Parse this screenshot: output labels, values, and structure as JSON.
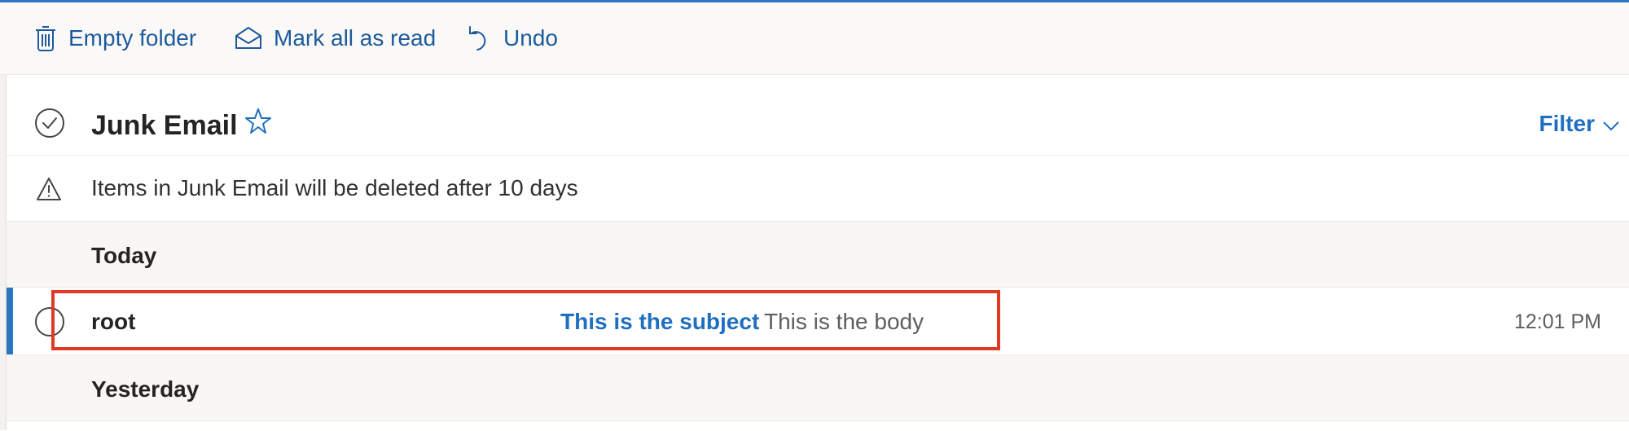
{
  "toolbar": {
    "empty_folder_label": "Empty folder",
    "mark_all_read_label": "Mark all as read",
    "undo_label": "Undo"
  },
  "folder": {
    "title": "Junk Email",
    "filter_label": "Filter"
  },
  "notice": {
    "text": "Items in Junk Email will be deleted after 10 days"
  },
  "groups": [
    {
      "label": "Today",
      "messages": [
        {
          "sender": "root",
          "subject": "This is the subject",
          "preview": "This is the body",
          "time": "12:01 PM"
        }
      ]
    },
    {
      "label": "Yesterday",
      "messages": []
    }
  ],
  "colors": {
    "accent": "#2b76c2",
    "link_blue": "#1f6fc0",
    "highlight_red": "#e03a26",
    "toolbar_bg": "#faf9f8"
  },
  "icons": {
    "empty_folder": "trash-icon",
    "mark_all_read": "envelope-open-icon",
    "undo": "undo-icon",
    "select_all": "check-circle-icon",
    "favorite": "star-icon",
    "filter": "chevron-down-icon",
    "notice": "warning-icon",
    "row_select": "circle-icon"
  }
}
